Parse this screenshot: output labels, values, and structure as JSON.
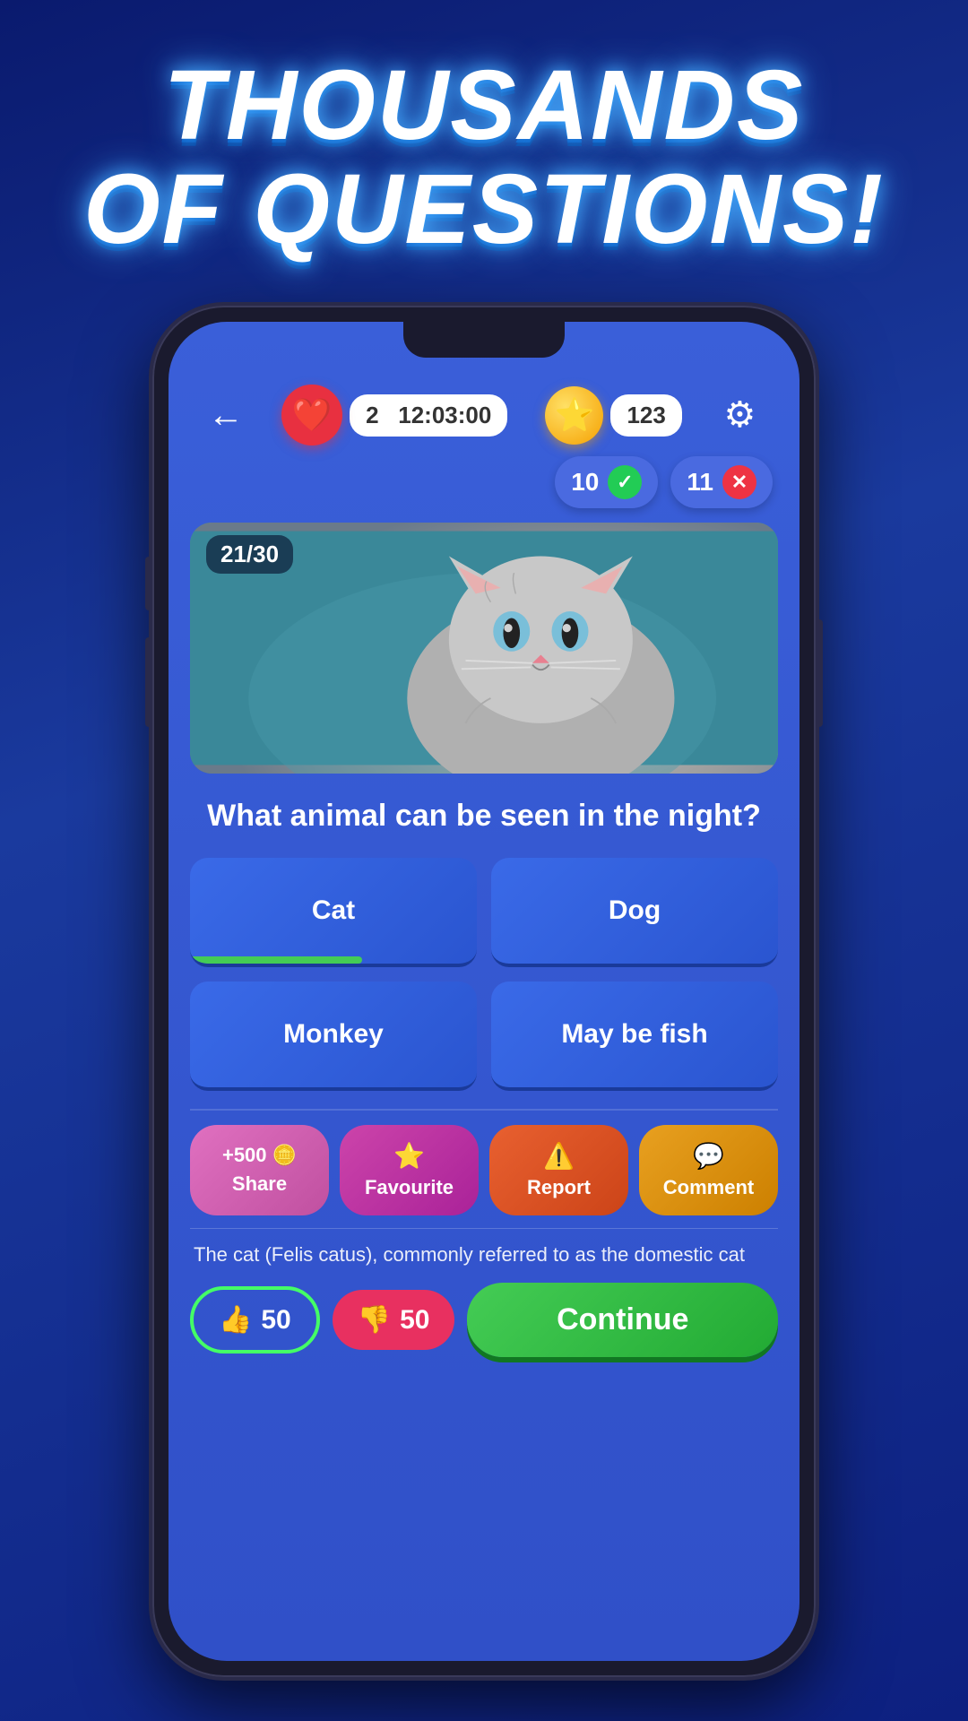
{
  "title": {
    "line1": "THOUSANDS",
    "line2": "OF QUESTIONS!"
  },
  "header": {
    "back_label": "←",
    "lives_count": "2",
    "timer": "12:03:00",
    "coins_count": "123",
    "gear_icon": "⚙"
  },
  "scores": {
    "correct_count": "10",
    "wrong_count": "11"
  },
  "question": {
    "counter": "21/30",
    "text": "What animal can be seen in the night?",
    "image_alt": "Cat photo"
  },
  "answers": {
    "a1": "Cat",
    "a2": "Dog",
    "a3": "Monkey",
    "a4": "May be fish"
  },
  "actions": {
    "share_label": "+500 🪙\nShare",
    "share_prefix": "+500",
    "share_text": "Share",
    "favourite_label": "Favourite",
    "report_label": "Report",
    "comment_label": "Comment"
  },
  "description": "The cat (Felis catus), commonly referred to as the domestic cat",
  "vote": {
    "up_count": "50",
    "down_count": "50",
    "continue_label": "Continue"
  }
}
